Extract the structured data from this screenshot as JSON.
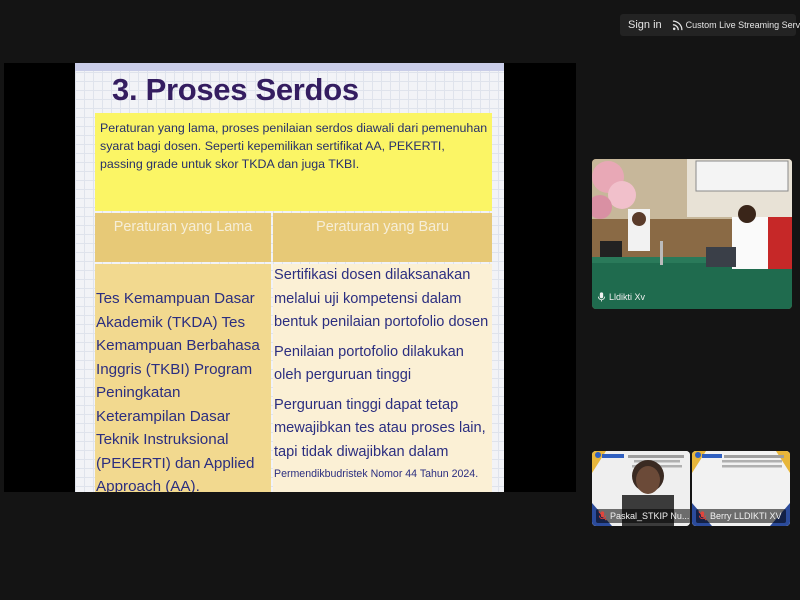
{
  "topbar": {
    "sign_in_label": "Sign in",
    "stream_icon": "live-stream-icon",
    "stream_label": "Custom Live Streaming Service",
    "stream_chevron": "chevron-down-icon"
  },
  "slide": {
    "title": "3. Proses Serdos",
    "intro_text": "Peraturan yang lama, proses penilaian serdos diawali dari pemenuhan syarat bagi dosen. Seperti kepemilikan sertifikat AA, PEKERTI, passing grade untuk skor TKDA dan juga TKBI.",
    "table": {
      "headers": [
        "Peraturan yang Lama",
        "Peraturan yang Baru"
      ],
      "old_rule": "Tes Kemampuan Dasar Akademik (TKDA) Tes Kemampuan Berbahasa Inggris (TKBI) Program Peningkatan Keterampilan Dasar Teknik Instruksional (PEKERTI) dan Applied Approach (AA).",
      "new_rules": [
        "Sertifikasi dosen dilaksanakan melalui uji kompetensi dalam bentuk penilaian portofolio dosen",
        "Penilaian portofolio dilakukan oleh perguruan tinggi",
        "Perguruan tinggi dapat tetap mewajibkan tes atau proses lain, tapi tidak diwajibkan dalam"
      ],
      "footnote": "Permendikbudristek Nomor 44 Tahun 2024."
    }
  },
  "participants": [
    {
      "name": "Lldikti Xv",
      "muted": false
    },
    {
      "name": "Paskal_STKIP Nu...",
      "muted": true
    },
    {
      "name": "Berry LLDIKTI XV",
      "muted": true
    }
  ],
  "colors": {
    "background": "#141414",
    "title": "#341d60",
    "intro_bg": "#fbf565",
    "header_bg": "#e7c977",
    "old_col_bg": "#f2d98f",
    "new_col_bg": "#fbf0d5",
    "body_text": "#2b2e80",
    "muted_red": "#e0463c"
  }
}
